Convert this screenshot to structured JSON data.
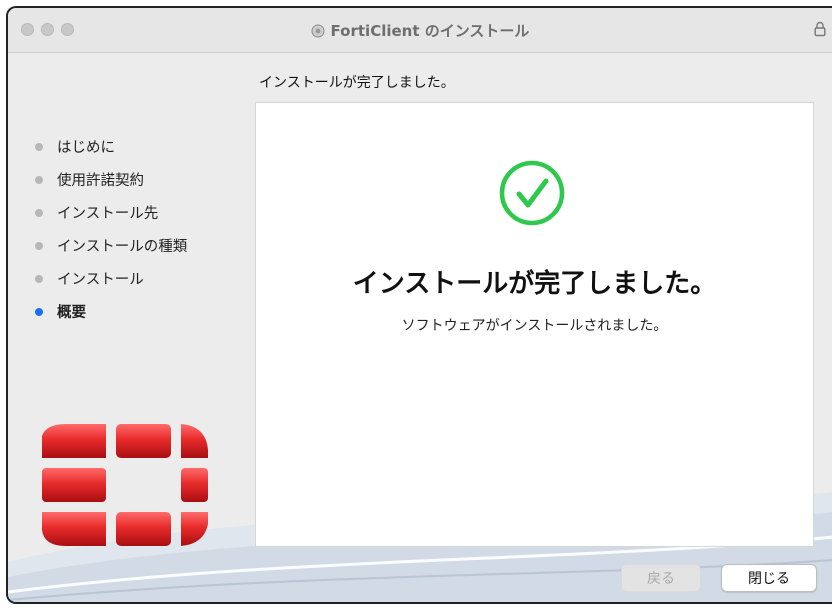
{
  "window": {
    "title": "FortiClient のインストール"
  },
  "header": {
    "page_heading": "インストールが完了しました。"
  },
  "sidebar": {
    "steps": [
      {
        "label": "はじめに",
        "active": false
      },
      {
        "label": "使用許諾契約",
        "active": false
      },
      {
        "label": "インストール先",
        "active": false
      },
      {
        "label": "インストールの種類",
        "active": false
      },
      {
        "label": "インストール",
        "active": false
      },
      {
        "label": "概要",
        "active": true
      }
    ]
  },
  "main": {
    "title": "インストールが完了しました。",
    "subtitle": "ソフトウェアがインストールされました。"
  },
  "buttons": {
    "back_label": "戻る",
    "close_label": "閉じる"
  },
  "colors": {
    "accent": "#1e6fe8",
    "success": "#2ec84c",
    "brand_red": "#e32b2b"
  },
  "icons": {
    "title": "installer-package-icon",
    "lock": "lock-icon",
    "success": "checkmark-circle-icon",
    "brand": "fortinet-logo"
  }
}
